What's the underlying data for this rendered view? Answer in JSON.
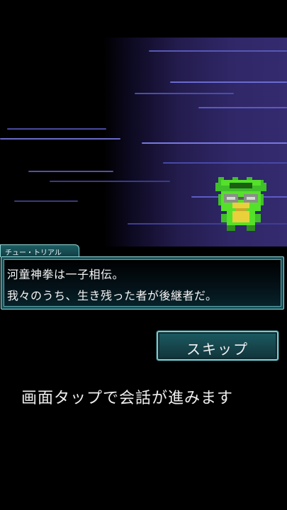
{
  "speaker": {
    "name": "チュー・トリアル"
  },
  "dialog": {
    "lines": [
      "河童神拳は一子相伝。",
      "我々のうち、生き残った者が後継者だ。"
    ]
  },
  "skip_button": {
    "label": "スキップ"
  },
  "hint": {
    "text": "画面タップで会話が進みます"
  },
  "character": {
    "icon": "kappa-sprite-icon"
  },
  "colors": {
    "background": "#000000",
    "scene_purple": "#342b70",
    "panel_teal": "#1b535a",
    "panel_border": "#8fd6d8",
    "character_green": "#55e02a",
    "text": "#f4f4f4"
  }
}
